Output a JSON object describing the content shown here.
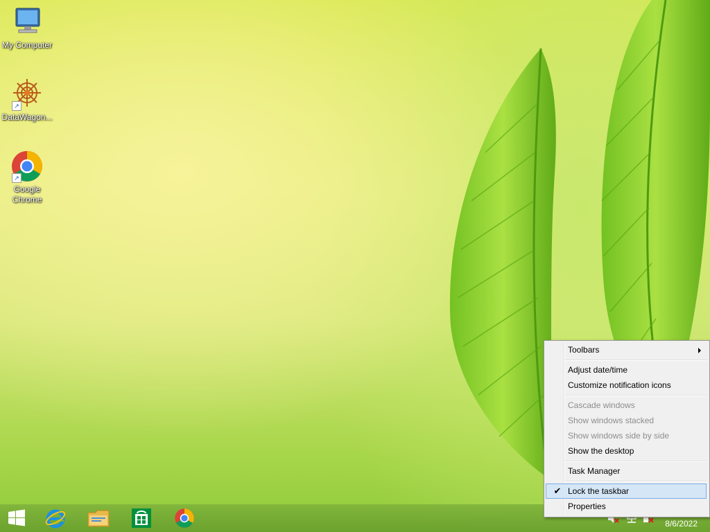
{
  "desktop": {
    "icons": [
      {
        "label": "My Computer"
      },
      {
        "label": "DataWagon..."
      },
      {
        "label": "Google Chrome"
      }
    ]
  },
  "taskbar": {
    "pinned": [
      {
        "icon": "windows-start-icon"
      },
      {
        "icon": "internet-explorer-icon"
      },
      {
        "icon": "file-explorer-icon"
      },
      {
        "icon": "windows-store-icon"
      },
      {
        "icon": "google-chrome-icon"
      }
    ],
    "tray": {
      "icons": [
        "volume-muted-icon",
        "network-icon",
        "action-center-icon"
      ],
      "date": "8/6/2022"
    }
  },
  "context_menu": {
    "items": [
      {
        "label": "Toolbars",
        "submenu": true,
        "enabled": true
      },
      {
        "label": "Adjust date/time",
        "enabled": true
      },
      {
        "label": "Customize notification icons",
        "enabled": true
      },
      {
        "label": "Cascade windows",
        "enabled": false
      },
      {
        "label": "Show windows stacked",
        "enabled": false
      },
      {
        "label": "Show windows side by side",
        "enabled": false
      },
      {
        "label": "Show the desktop",
        "enabled": true
      },
      {
        "label": "Task Manager",
        "enabled": true
      },
      {
        "label": "Lock the taskbar",
        "enabled": true,
        "checked": true,
        "highlighted": true
      },
      {
        "label": "Properties",
        "enabled": true
      }
    ],
    "check_mark": "✔"
  },
  "colors": {
    "taskbar": "#7ab23c",
    "menu_bg": "#f0f0f0",
    "menu_highlight": "#d5e6f7"
  }
}
